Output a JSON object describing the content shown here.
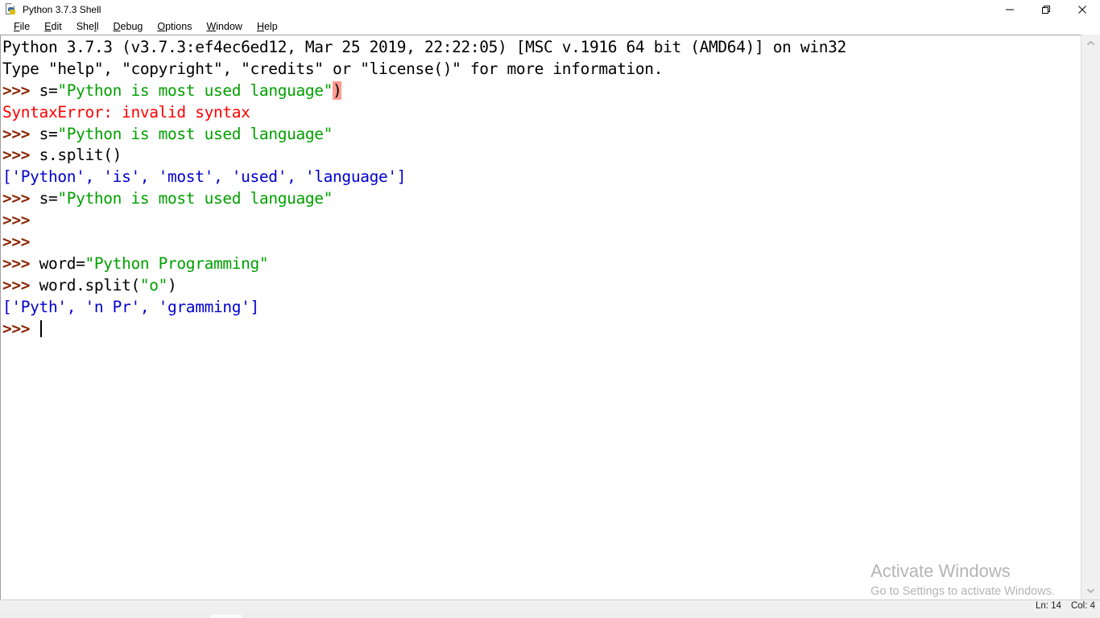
{
  "window": {
    "title": "Python 3.7.3 Shell",
    "icon": "idle-python-icon",
    "controls": [
      {
        "name": "minimize",
        "glyph": "minimize-icon"
      },
      {
        "name": "restore",
        "glyph": "restore-icon"
      },
      {
        "name": "close",
        "glyph": "close-icon"
      }
    ]
  },
  "menubar": {
    "items": [
      {
        "label": "File",
        "accel": "F",
        "before": "",
        "after": "ile"
      },
      {
        "label": "Edit",
        "accel": "E",
        "before": "",
        "after": "dit"
      },
      {
        "label": "Shell",
        "accel": "l",
        "before": "She",
        "after": "l"
      },
      {
        "label": "Debug",
        "accel": "D",
        "before": "",
        "after": "ebug"
      },
      {
        "label": "Options",
        "accel": "O",
        "before": "",
        "after": "ptions"
      },
      {
        "label": "Window",
        "accel": "W",
        "before": "",
        "after": "indow"
      },
      {
        "label": "Help",
        "accel": "H",
        "before": "",
        "after": "elp"
      }
    ]
  },
  "console": {
    "lines": [
      {
        "id": 1,
        "spans": [
          {
            "text": "Python 3.7.3 (v3.7.3:ef4ec6ed12, Mar 25 2019, 22:22:05) [MSC v.1916 64 bit (AMD64)] on win32",
            "style": "c-default"
          }
        ]
      },
      {
        "id": 2,
        "spans": [
          {
            "text": "Type \"help\", \"copyright\", \"credits\" or \"license()\" for more information.",
            "style": "c-default"
          }
        ]
      },
      {
        "id": 3,
        "spans": [
          {
            "text": ">>> ",
            "style": "c-prompt"
          },
          {
            "text": "s=",
            "style": "c-default"
          },
          {
            "text": "\"Python is most used language\"",
            "style": "c-string"
          },
          {
            "text": ")",
            "style": "c-hl"
          }
        ]
      },
      {
        "id": 4,
        "spans": [
          {
            "text": "SyntaxError: invalid syntax",
            "style": "c-error"
          }
        ]
      },
      {
        "id": 5,
        "spans": [
          {
            "text": ">>> ",
            "style": "c-prompt"
          },
          {
            "text": "s=",
            "style": "c-default"
          },
          {
            "text": "\"Python is most used language\"",
            "style": "c-string"
          }
        ]
      },
      {
        "id": 6,
        "spans": [
          {
            "text": ">>> ",
            "style": "c-prompt"
          },
          {
            "text": "s.split()",
            "style": "c-default"
          }
        ]
      },
      {
        "id": 7,
        "spans": [
          {
            "text": "['Python', 'is', 'most', 'used', 'language']",
            "style": "c-output"
          }
        ]
      },
      {
        "id": 8,
        "spans": [
          {
            "text": ">>> ",
            "style": "c-prompt"
          },
          {
            "text": "s=",
            "style": "c-default"
          },
          {
            "text": "\"Python is most used language\"",
            "style": "c-string"
          }
        ]
      },
      {
        "id": 9,
        "spans": [
          {
            "text": ">>> ",
            "style": "c-prompt"
          }
        ]
      },
      {
        "id": 10,
        "spans": [
          {
            "text": ">>> ",
            "style": "c-prompt"
          }
        ]
      },
      {
        "id": 11,
        "spans": [
          {
            "text": ">>> ",
            "style": "c-prompt"
          },
          {
            "text": "word=",
            "style": "c-default"
          },
          {
            "text": "\"Python Programming\"",
            "style": "c-string"
          }
        ]
      },
      {
        "id": 12,
        "spans": [
          {
            "text": ">>> ",
            "style": "c-prompt"
          },
          {
            "text": "word.split(",
            "style": "c-default"
          },
          {
            "text": "\"o\"",
            "style": "c-string"
          },
          {
            "text": ")",
            "style": "c-default"
          }
        ]
      },
      {
        "id": 13,
        "spans": [
          {
            "text": "['Pyth', 'n Pr', 'gramming']",
            "style": "c-output"
          }
        ]
      },
      {
        "id": 14,
        "spans": [
          {
            "text": ">>> ",
            "style": "c-prompt"
          }
        ],
        "caret": true
      }
    ]
  },
  "scrollbar": {
    "up_arrow": "chevron-up-icon",
    "down_arrow": "chevron-down-icon"
  },
  "watermark": {
    "title": "Activate Windows",
    "subtitle": "Go to Settings to activate Windows."
  },
  "statusbar": {
    "line_label": "Ln: 14",
    "col_label": "Col: 4"
  },
  "colors": {
    "prompt": "#8b2500",
    "string": "#00a000",
    "output": "#0000cc",
    "error": "#ff0000",
    "highlight_bg": "#ff9b91",
    "watermark": "#b4b4b4",
    "background": "#ffffff"
  }
}
